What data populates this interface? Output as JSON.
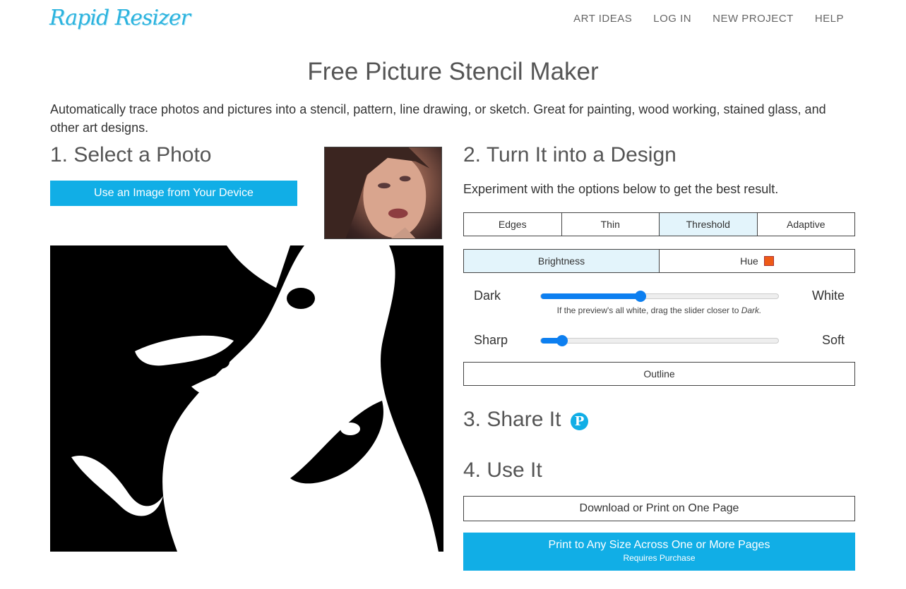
{
  "brand": {
    "logo_text": "Rapid Resizer"
  },
  "nav": {
    "items": [
      "ART IDEAS",
      "LOG IN",
      "NEW PROJECT",
      "HELP"
    ]
  },
  "page_title": "Free Picture Stencil Maker",
  "intro": "Automatically trace photos and pictures into a stencil, pattern, line drawing, or sketch. Great for painting, wood working, stained glass, and other art designs.",
  "step1": {
    "heading": "1. Select a Photo",
    "button_label": "Use an Image from Your Device"
  },
  "step2": {
    "heading": "2. Turn It into a Design",
    "description": "Experiment with the options below to get the best result.",
    "modes": [
      "Edges",
      "Thin",
      "Threshold",
      "Adaptive"
    ],
    "active_mode": "Threshold",
    "channels": [
      "Brightness",
      "Hue"
    ],
    "active_channel": "Brightness",
    "hue_color": "#ee5a16",
    "dark_slider": {
      "left_label": "Dark",
      "right_label": "White",
      "value": 0.42
    },
    "hint_prefix": "If the preview's all white, drag the slider closer to ",
    "hint_emphasis": "Dark.",
    "sharp_slider": {
      "left_label": "Sharp",
      "right_label": "Soft",
      "value": 0.09
    },
    "outline_label": "Outline"
  },
  "step3": {
    "heading": "3. Share It",
    "share_icon": "pinterest-icon"
  },
  "step4": {
    "heading": "4. Use It",
    "download_label": "Download or Print on One Page",
    "print_label": "Print to Any Size Across One or More Pages",
    "print_sub": "Requires Purchase"
  },
  "colors": {
    "accent": "#11aee6",
    "slider": "#0d7ff0",
    "active_bg": "#e3f4fb"
  }
}
